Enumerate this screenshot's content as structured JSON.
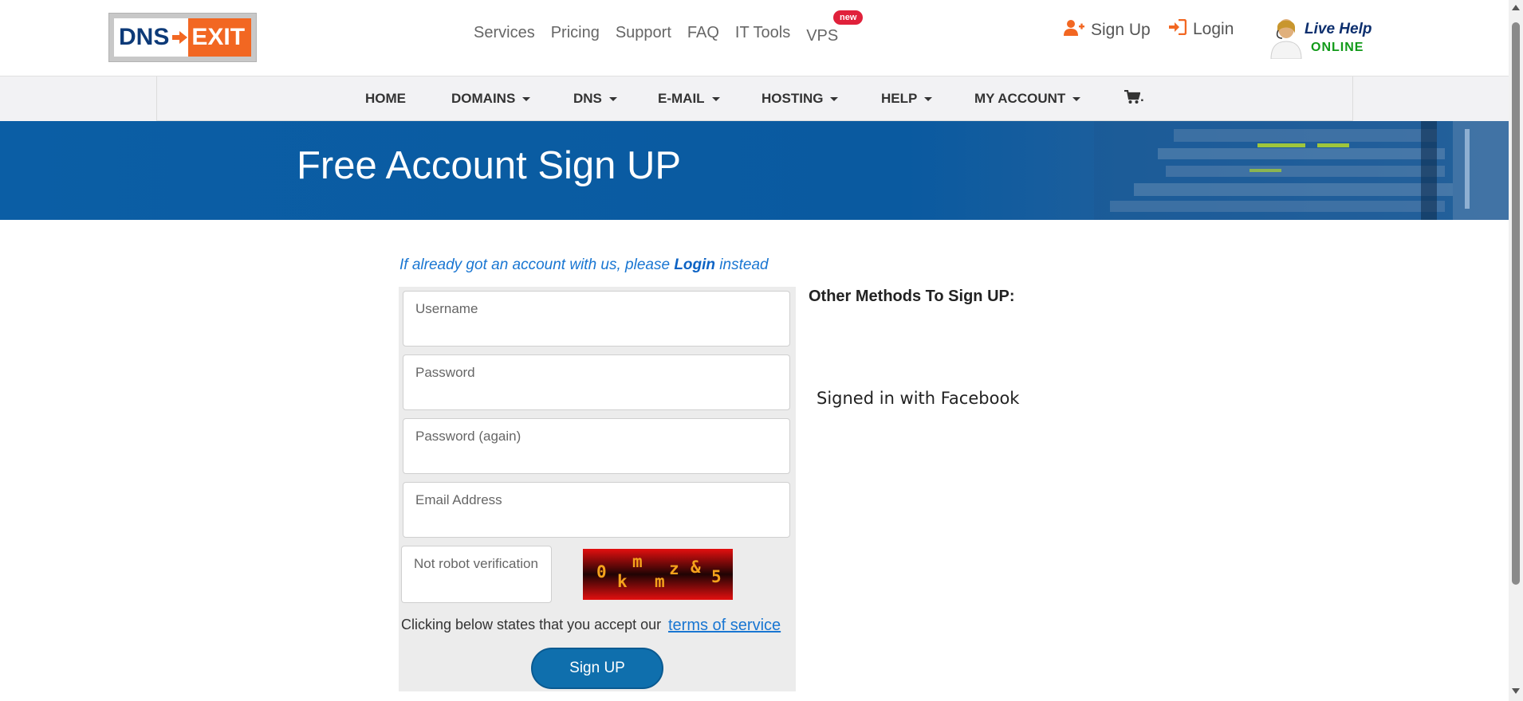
{
  "header": {
    "logo": {
      "left_text": "DNS",
      "right_text": "EXIT"
    },
    "nav": [
      "Services",
      "Pricing",
      "Support",
      "FAQ",
      "IT Tools",
      "VPS"
    ],
    "vps_badge": "new",
    "signup_label": "Sign Up",
    "login_label": "Login",
    "live_help": {
      "line1": "Live Help",
      "line2": "ONLINE"
    },
    "icon_color": "#f26722"
  },
  "main_nav": {
    "items": [
      "HOME",
      "DOMAINS",
      "DNS",
      "E-MAIL",
      "HOSTING",
      "HELP",
      "MY ACCOUNT"
    ],
    "cart_label": "."
  },
  "banner": {
    "title": "Free Account Sign UP"
  },
  "form": {
    "login_note_before": "If already got an account with us, please ",
    "login_note_link": "Login",
    "login_note_after": " instead",
    "username_placeholder": "Username",
    "password_placeholder": "Password",
    "password_again_placeholder": "Password (again)",
    "email_placeholder": "Email Address",
    "captcha_placeholder": "Not robot verification",
    "captcha_chars": [
      "0",
      "k",
      "m",
      "m",
      "z",
      "&",
      "5"
    ],
    "tos_text": "Clicking below states that you accept our",
    "tos_link": "terms of service",
    "submit_label": "Sign UP"
  },
  "other_methods": {
    "title": "Other Methods To Sign UP:",
    "facebook_status": "Signed in with Facebook"
  },
  "colors": {
    "brand_blue": "#0b5ea5",
    "brand_orange": "#f26722",
    "button_blue": "#0f6fad",
    "link_blue": "#1976d2"
  }
}
